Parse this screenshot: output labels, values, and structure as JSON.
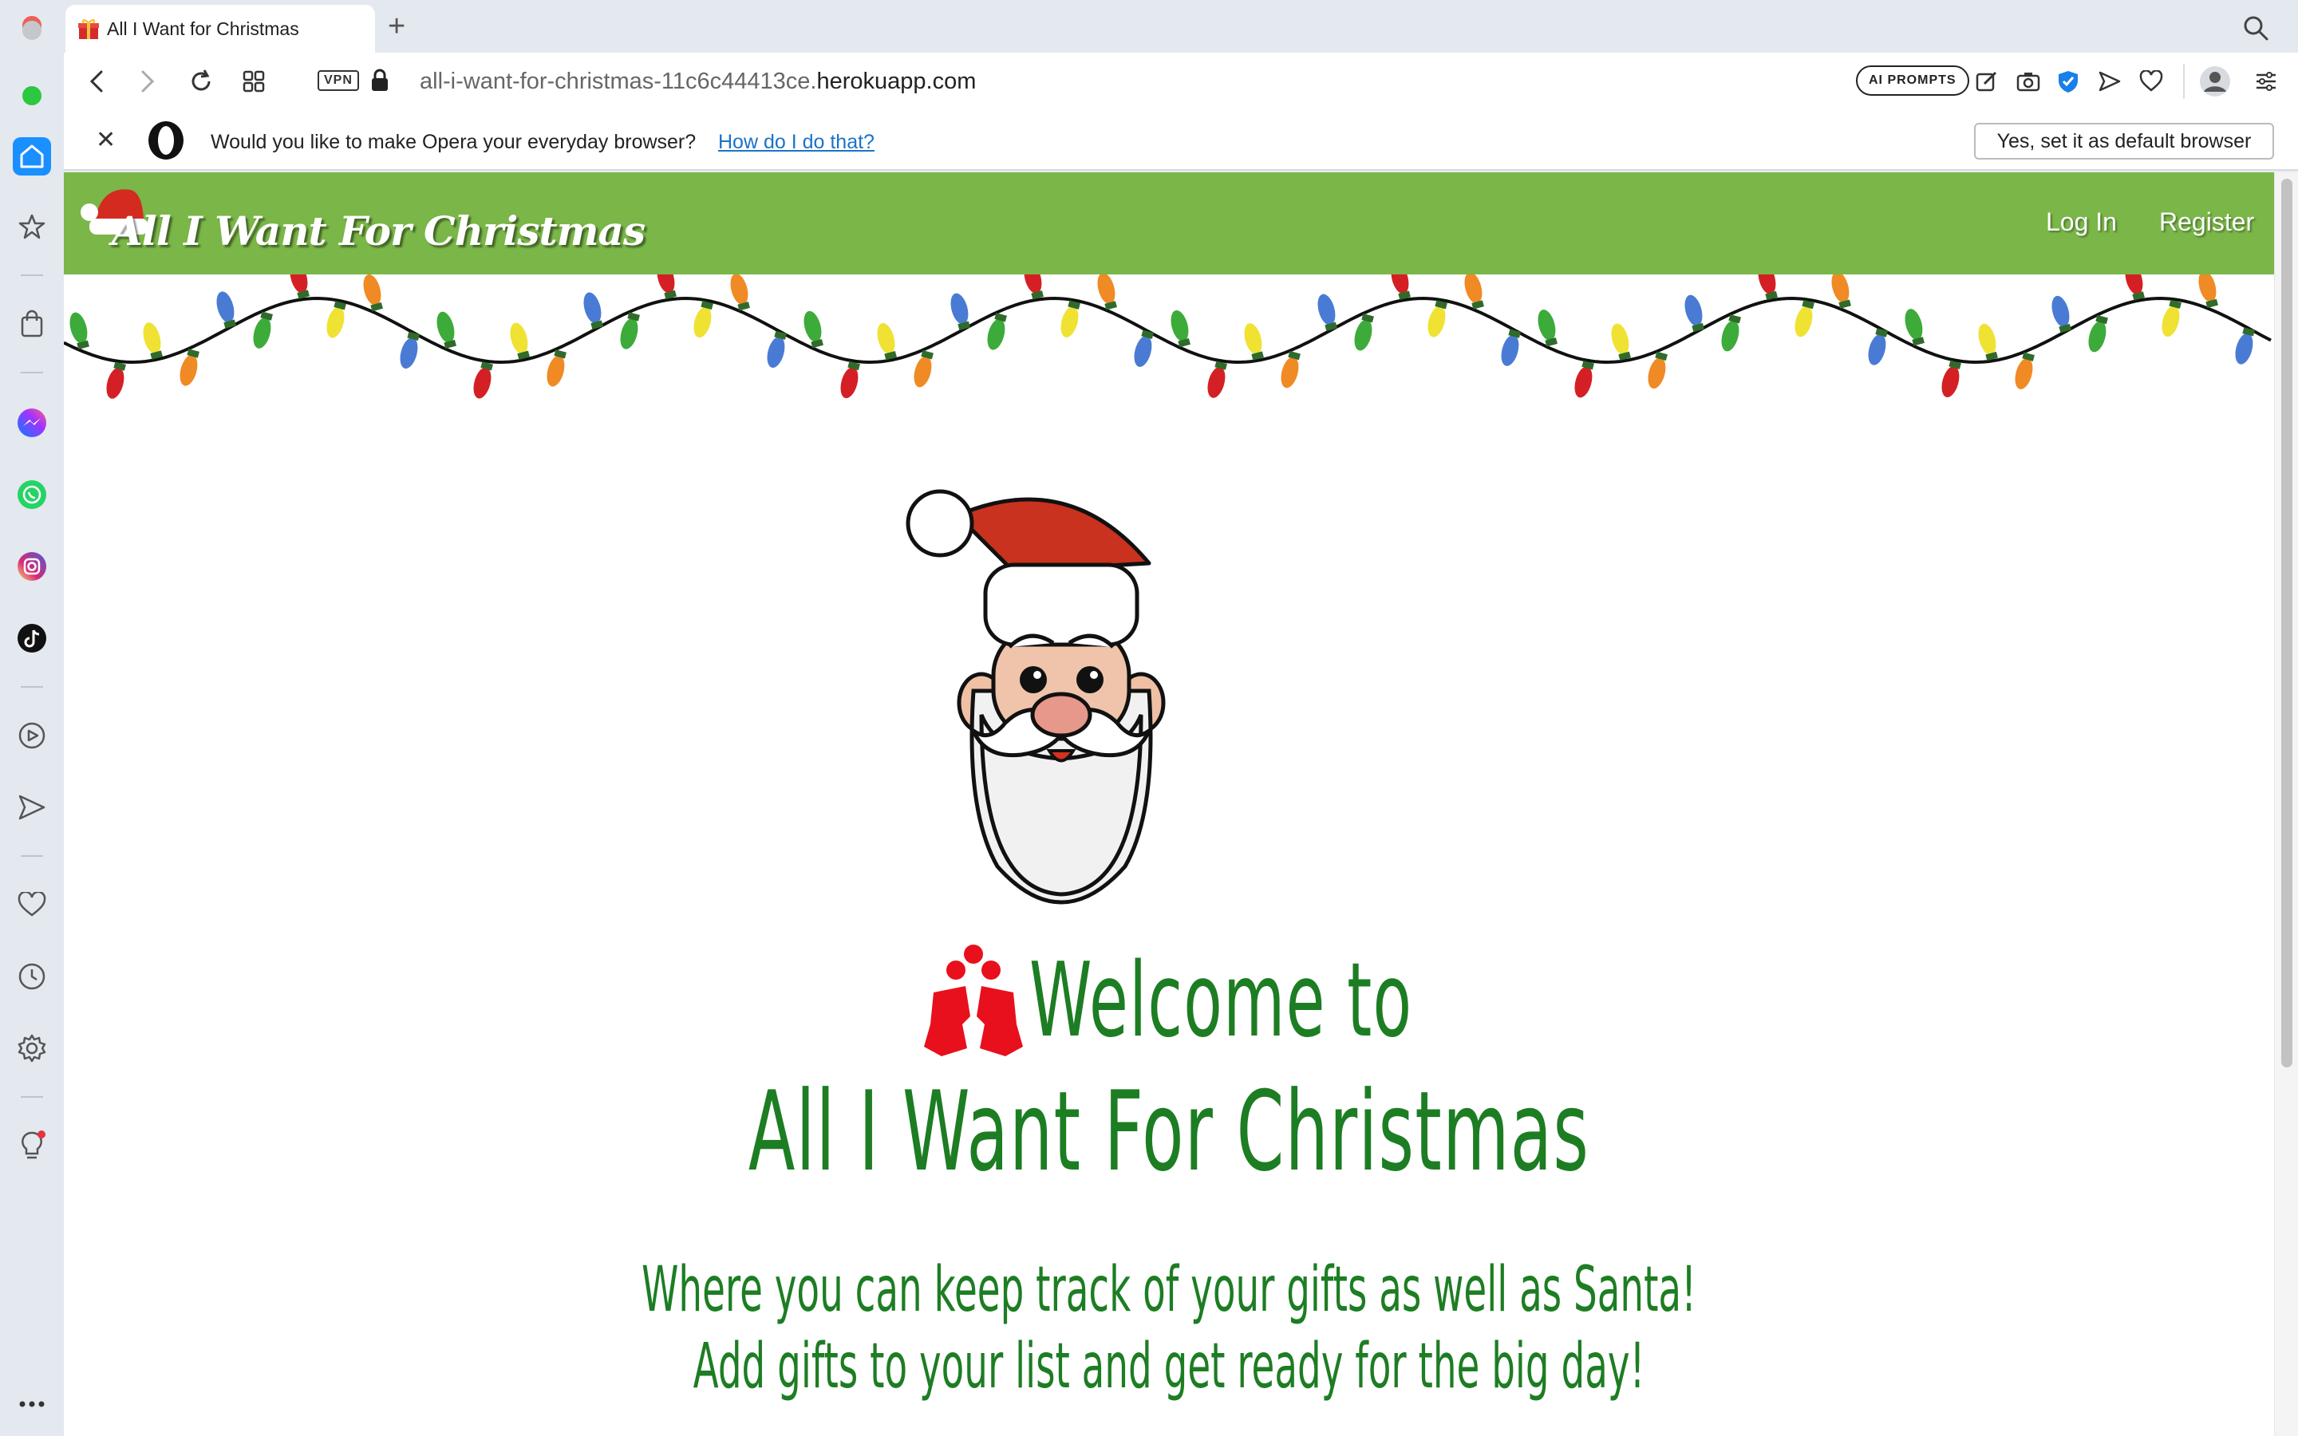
{
  "browser": {
    "tab": {
      "title": "All I Want for Christmas"
    },
    "address": {
      "url_prefix": "all-i-want-for-christmas-11c6c44413ce.",
      "url_domain": "herokuapp.com"
    },
    "vpn_label": "VPN",
    "ai_prompts_label": "AI PROMPTS",
    "infobar": {
      "message": "Would you like to make Opera your everyday browser?",
      "link": "How do I do that?",
      "button": "Yes, set it as default browser"
    },
    "sidebar_icons": [
      "home-icon",
      "star-icon",
      "bag-icon",
      "messenger-icon",
      "whatsapp-icon",
      "instagram-icon",
      "tiktok-icon",
      "player-icon",
      "send-icon",
      "heart-icon",
      "history-icon",
      "settings-icon",
      "lightbulb-icon",
      "more-icon"
    ]
  },
  "site": {
    "brand": "All I Want For Christmas",
    "nav": {
      "login": "Log In",
      "register": "Register"
    },
    "hero": {
      "welcome_line1": "Welcome to",
      "welcome_line2": "All I Want For Christmas",
      "tagline_line1": "Where you can keep track of your gifts as well as Santa!",
      "tagline_line2": "Add gifts to your list and get ready for the big day!"
    }
  },
  "colors": {
    "nav_green": "#7ab648",
    "heading_green": "#1d7d23",
    "link_blue": "#1a73c8"
  }
}
